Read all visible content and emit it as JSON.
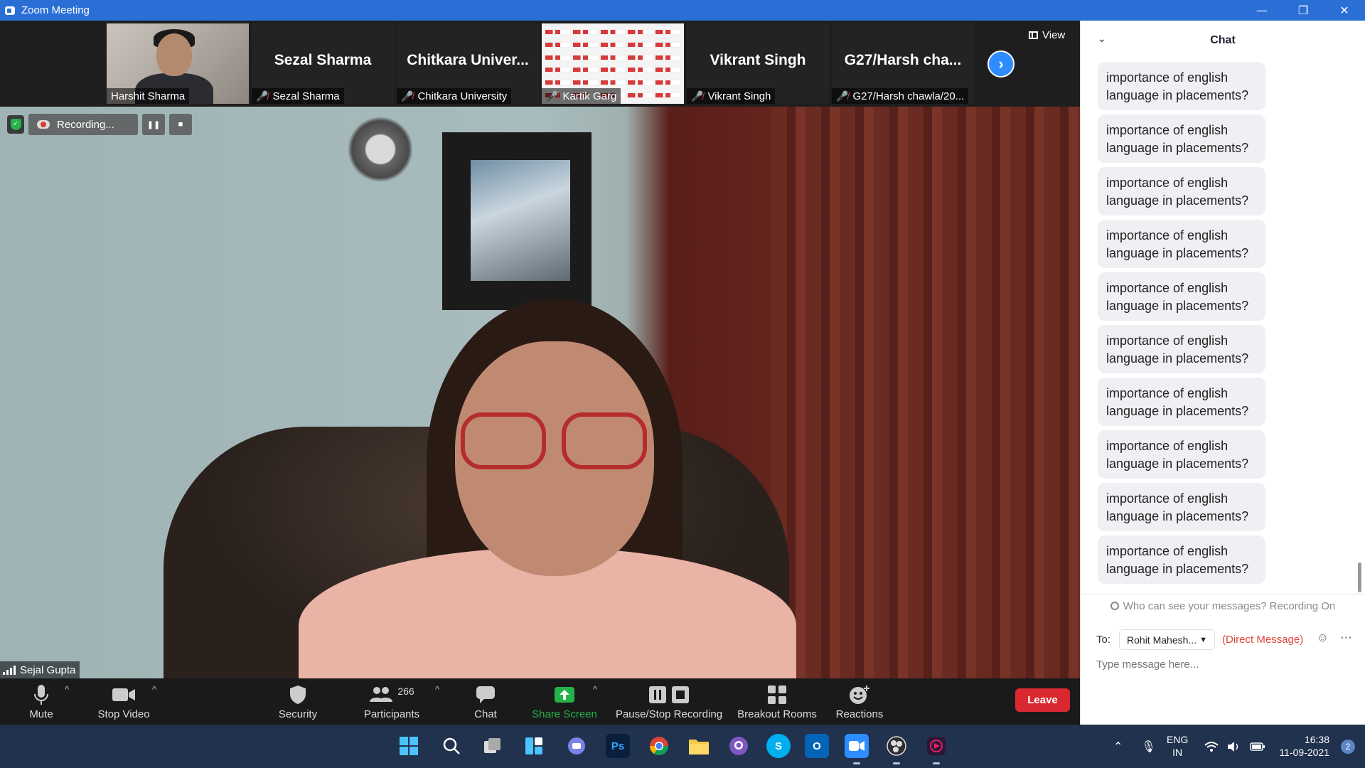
{
  "window": {
    "title": "Zoom Meeting",
    "minimize": "—",
    "restore": "❐",
    "close": "✕"
  },
  "thumbnails": [
    {
      "label": "Harshit Sharma",
      "big_name": "",
      "type": "photo",
      "muted": false
    },
    {
      "label": "Sezal Sharma",
      "big_name": "Sezal Sharma",
      "type": "name",
      "muted": true
    },
    {
      "label": "Chitkara University",
      "big_name": "Chitkara  Univer...",
      "type": "name",
      "muted": true
    },
    {
      "label": "Kartik Garg",
      "big_name": "",
      "type": "grid",
      "muted": true
    },
    {
      "label": "Vikrant Singh",
      "big_name": "Vikrant Singh",
      "type": "name",
      "muted": true
    },
    {
      "label": "G27/Harsh chawla/20...",
      "big_name": "G27/Harsh  cha...",
      "type": "name",
      "muted": true
    }
  ],
  "view_button": "View",
  "recording": {
    "status": "Recording...",
    "pause": "❚❚",
    "stop": "■"
  },
  "speaker_name": "Sejal Gupta",
  "toolbar": {
    "mute": "Mute",
    "stop_video": "Stop Video",
    "security": "Security",
    "participants": "Participants",
    "participants_count": "266",
    "chat": "Chat",
    "share_screen": "Share Screen",
    "pause_stop_recording": "Pause/Stop Recording",
    "breakout_rooms": "Breakout Rooms",
    "reactions": "Reactions",
    "leave": "Leave",
    "caret": "^"
  },
  "chat": {
    "title": "Chat",
    "messages": [
      "importance of english language in placements?",
      "importance of english language in placements?",
      "importance of english language in placements?",
      "importance of english language in placements?",
      "importance of english language in placements?",
      "importance of english language in placements?",
      "importance of english language in placements?",
      "importance of english language in placements?",
      "importance of english language in placements?",
      "importance of english language in placements?"
    ],
    "visibility_notice": "Who can see your messages? Recording On",
    "to_label": "To:",
    "recipient": "Rohit Mahesh...",
    "direct_message": "(Direct Message)",
    "placeholder": "Type message here..."
  },
  "taskbar": {
    "apps": [
      "start",
      "search",
      "task-view",
      "widgets",
      "teams",
      "photoshop",
      "chrome",
      "file-explorer",
      "github",
      "skype",
      "outlook",
      "zoom",
      "obs",
      "media"
    ],
    "photoshop_label": "Ps",
    "skype_label": "S",
    "outlook_label": "O",
    "lang_line1": "ENG",
    "lang_line2": "IN",
    "time": "16:38",
    "date": "11-09-2021",
    "notifications": "2"
  },
  "colors": {
    "titlebar": "#2a6fd6",
    "leave": "#d9282f",
    "share_green": "#24b24a",
    "accent_blue": "#2d8cff",
    "direct_message_red": "#e0483d"
  }
}
